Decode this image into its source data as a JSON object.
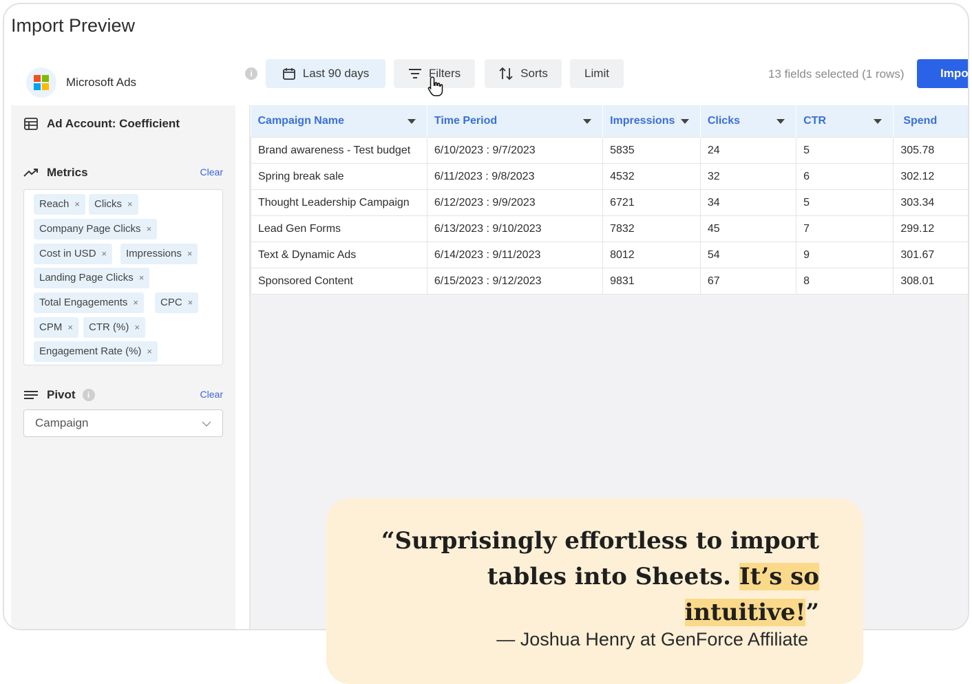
{
  "window": {
    "title": "Import Preview"
  },
  "source": {
    "name": "Microsoft Ads",
    "logo_colors": [
      "#f25022",
      "#7fba00",
      "#00a4ef",
      "#ffb900"
    ]
  },
  "sidebar": {
    "account_label": "Ad Account: Coefficient",
    "metrics_label": "Metrics",
    "metrics_clear": "Clear",
    "metrics": [
      "Reach",
      "Clicks",
      "Company Page Clicks",
      "Cost in USD",
      "Impressions",
      "Landing Page Clicks",
      "Total Engagements",
      "CPC",
      "CPM",
      "CTR (%)",
      "Engagement Rate (%)"
    ],
    "chip_remove": "×",
    "pivot_label": "Pivot",
    "pivot_clear": "Clear",
    "pivot_value": "Campaign"
  },
  "toolbar": {
    "dates_label": "Last 90 days",
    "filters_label": "Filters",
    "sorts_label": "Sorts",
    "limit_label": "Limit",
    "fields_status": "13 fields selected (1 rows)",
    "import_label": "Import"
  },
  "table": {
    "columns": [
      "Campaign Name",
      "Time Period",
      "Impressions",
      "Clicks",
      "CTR",
      "Spend"
    ],
    "rows": [
      [
        "Brand awareness - Test budget",
        "6/10/2023 : 9/7/2023",
        "5835",
        "24",
        "5",
        "305.78"
      ],
      [
        "Spring break sale",
        "6/11/2023 : 9/8/2023",
        "4532",
        "32",
        "6",
        "302.12"
      ],
      [
        "Thought Leadership Campaign",
        "6/12/2023 : 9/9/2023",
        "6721",
        "34",
        "5",
        "303.34"
      ],
      [
        "Lead Gen Forms",
        "6/13/2023 : 9/10/2023",
        "7832",
        "45",
        "7",
        "299.12"
      ],
      [
        "Text & Dynamic Ads",
        "6/14/2023 : 9/11/2023",
        "8012",
        "54",
        "9",
        "301.67"
      ],
      [
        "Sponsored Content",
        "6/15/2023 : 9/12/2023",
        "9831",
        "67",
        "8",
        "308.01"
      ]
    ]
  },
  "quote": {
    "text_start": "“Surprisingly effortless to import tables into Sheets. ",
    "text_highlight": "It’s so intuitive!",
    "text_end": "”",
    "attribution": "— Joshua Henry at GenForce Affiliate"
  },
  "colors": {
    "accent": "#2a62e8",
    "header_bg": "#e6f1fb",
    "header_text": "#3b6fd6",
    "quote_bg": "#fdf0d6",
    "highlight": "#fbd98a"
  }
}
